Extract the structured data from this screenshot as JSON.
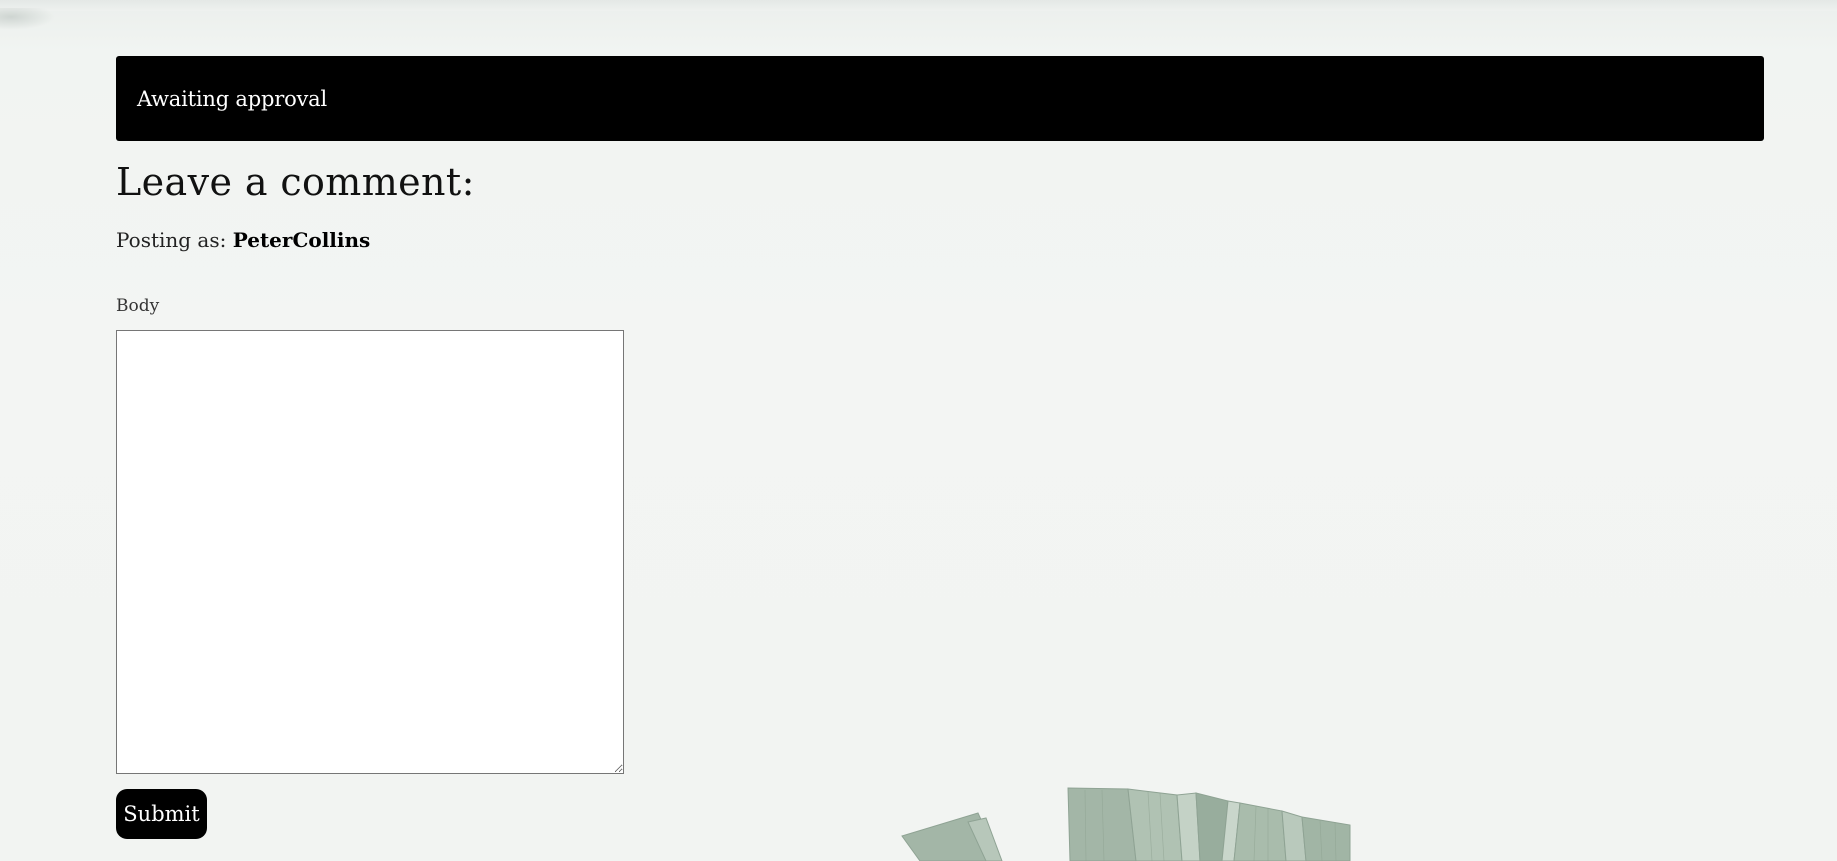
{
  "alert": {
    "message": "Awaiting approval"
  },
  "comment_form": {
    "heading": "Leave a comment:",
    "posting_as_label": "Posting as:",
    "username": "PeterCollins",
    "body_label": "Body",
    "body_value": "",
    "submit_label": "Submit"
  },
  "colors": {
    "alert_background": "#000000",
    "alert_text": "#ffffff",
    "page_background": "#f2f4f2",
    "button_background": "#000000",
    "leaf_green": "#9fb3a4"
  },
  "decoration": {
    "background_image": "leaves-image"
  }
}
